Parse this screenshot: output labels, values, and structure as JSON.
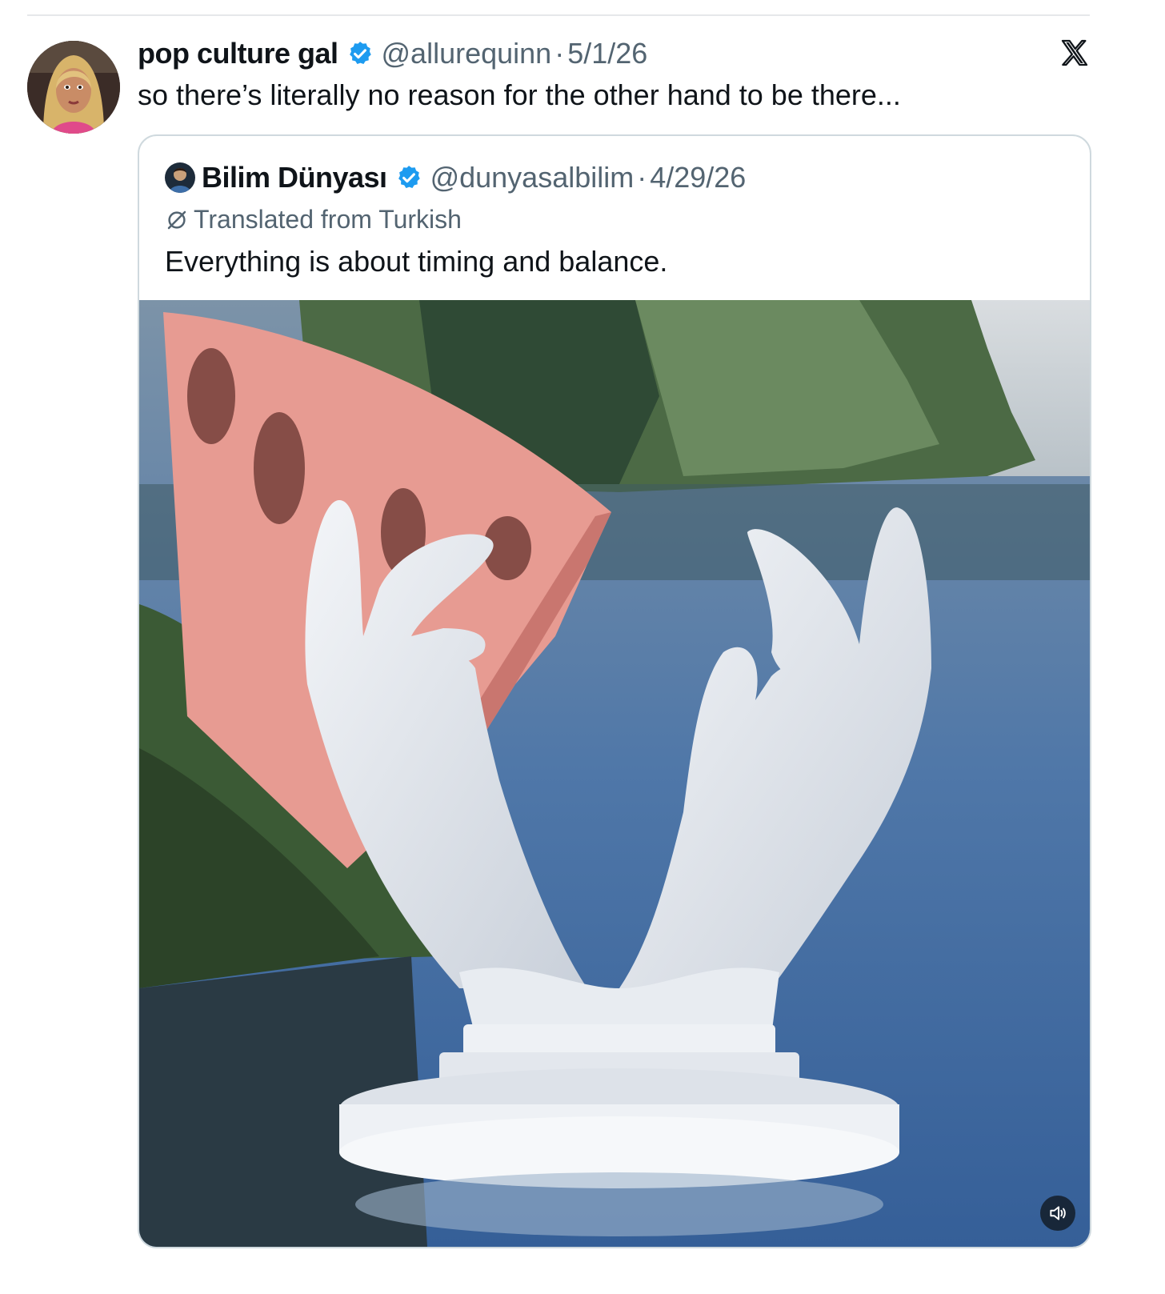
{
  "tweet": {
    "author": {
      "display_name": "pop culture gal",
      "handle": "@allurequinn",
      "verified": true
    },
    "separator": "·",
    "date": "5/1/26",
    "text": "so there’s literally no reason for the other hand to be there..."
  },
  "quoted_tweet": {
    "author": {
      "display_name": "Bilim Dünyası",
      "handle": "@dunyasalbilim",
      "verified": true
    },
    "separator": "·",
    "date": "4/29/26",
    "translation_note": "Translated from Turkish",
    "text": "Everything is about timing and balance.",
    "media": {
      "type": "video",
      "subject": "white stone hands sculpture in a lake holding a pink slab"
    }
  },
  "icons": {
    "verified": "verified-badge-icon",
    "platform": "x-logo-icon",
    "translate": "translate-icon",
    "sound": "speaker-icon"
  },
  "colors": {
    "verified_blue": "#1d9bf0",
    "secondary_text": "#536471",
    "primary_text": "#0f1419",
    "card_border": "#cfd9de"
  }
}
